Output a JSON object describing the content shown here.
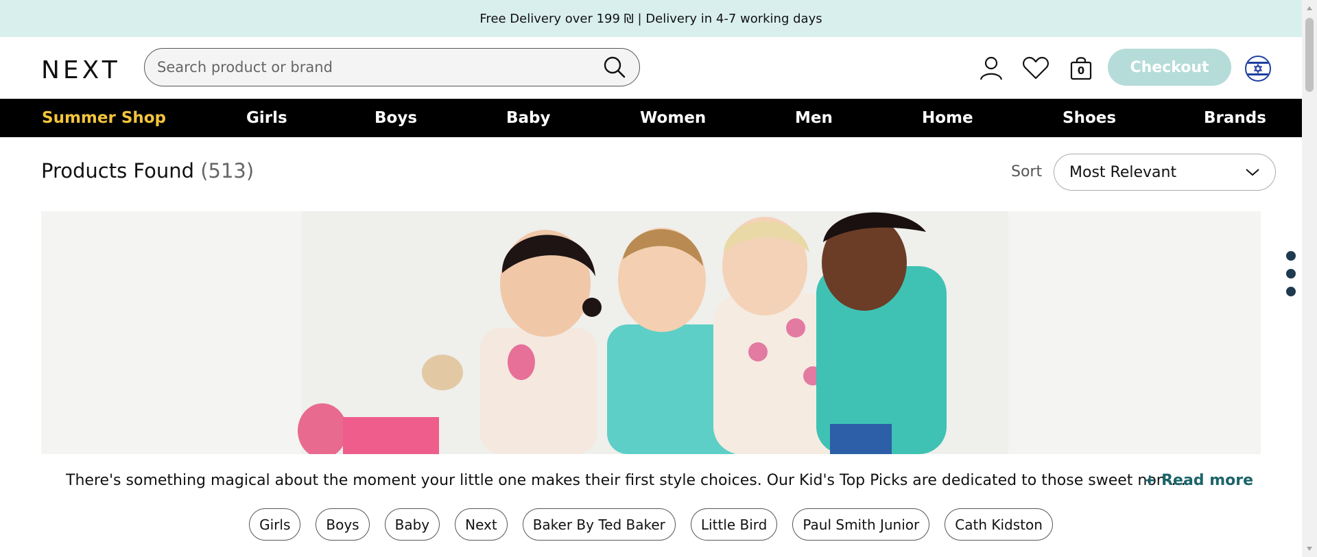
{
  "promo": {
    "text": "Free Delivery over 199 ₪ | Delivery in 4-7 working days"
  },
  "header": {
    "logo": "NEXT",
    "search_placeholder": "Search product or brand",
    "bag_count": "0",
    "checkout_label": "Checkout"
  },
  "nav": {
    "items": [
      {
        "label": "Summer Shop"
      },
      {
        "label": "Girls"
      },
      {
        "label": "Boys"
      },
      {
        "label": "Baby"
      },
      {
        "label": "Women"
      },
      {
        "label": "Men"
      },
      {
        "label": "Home"
      },
      {
        "label": "Shoes"
      },
      {
        "label": "Brands"
      }
    ],
    "highlight_color": "#f3c43c"
  },
  "results": {
    "title": "Products Found",
    "count": "(513)"
  },
  "sort": {
    "label": "Sort",
    "selected": "Most Relevant"
  },
  "description": {
    "text": "There's something magical about the moment your little one makes their first style choices. Our Kid's Top Picks are dedicated to those sweet non-...",
    "read_more": "+ Read more"
  },
  "filters": {
    "chips": [
      {
        "label": "Girls"
      },
      {
        "label": "Boys"
      },
      {
        "label": "Baby"
      },
      {
        "label": "Next"
      },
      {
        "label": "Baker By Ted Baker"
      },
      {
        "label": "Little Bird"
      },
      {
        "label": "Paul Smith Junior"
      },
      {
        "label": "Cath Kidston"
      }
    ]
  },
  "colors": {
    "promo_bg": "#d9efee",
    "checkout_bg": "#b5dcd9",
    "accent_teal": "#1b6469"
  }
}
